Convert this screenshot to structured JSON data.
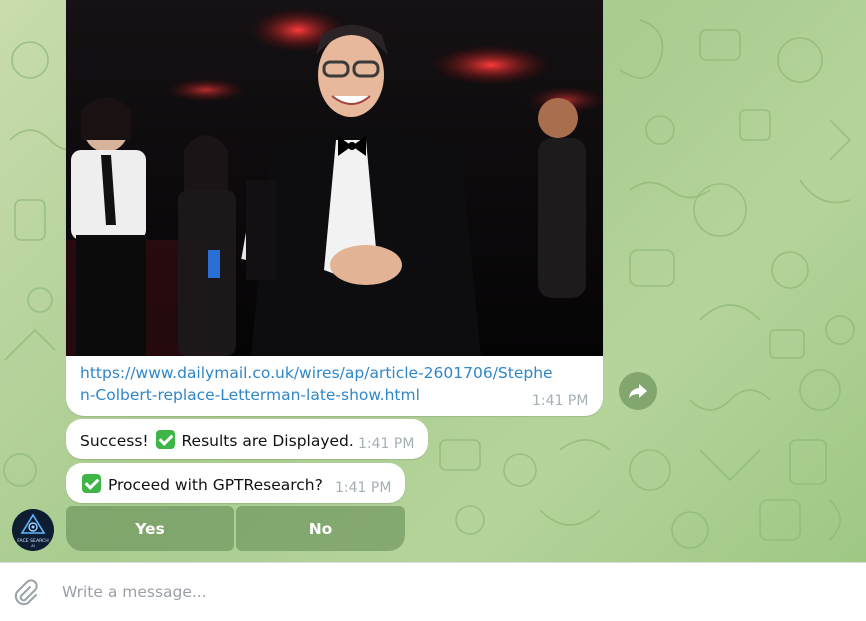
{
  "colors": {
    "link": "#2f86c9",
    "timestamp": "#a5b0b5",
    "keyboard_button_bg": "#6f9863",
    "bubble_bg": "#ffffff",
    "success_check": "#3fb548"
  },
  "messages": {
    "photo_link": {
      "url": "https://www.dailymail.co.uk/wires/ap/article-2601706/Stephen-Colbert-replace-Letterman-late-show.html",
      "time": "1:41 PM"
    },
    "success": {
      "prefix": "Success!",
      "suffix": "Results are Displayed.",
      "time": "1:41 PM"
    },
    "proceed": {
      "text": "Proceed with GPTResearch?",
      "time": "1:41 PM"
    }
  },
  "keyboard": {
    "yes_label": "Yes",
    "no_label": "No"
  },
  "avatar": {
    "caption": "FACE SEARCH",
    "subcaption": "AI"
  },
  "composer": {
    "placeholder": "Write a message..."
  },
  "icons": {
    "share": "share-arrow-icon",
    "attach": "paperclip-icon",
    "check": "check-mark-icon"
  }
}
